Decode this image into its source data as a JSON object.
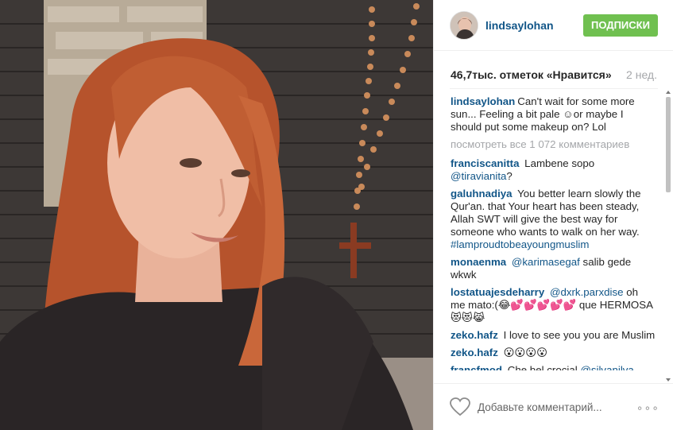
{
  "post": {
    "username": "lindsaylohan",
    "follow_label": "ПОДПИСКИ",
    "likes_text": "46,7тыс. отметок «Нравится»",
    "time_ago": "2 нед."
  },
  "caption": {
    "user": "lindsaylohan",
    "text": "Can't wait for some more sun... Feeling a bit pale ☺or maybe I should put some makeup on? Lol"
  },
  "view_all_text": "посмотреть все 1 072 комментариев",
  "comments": [
    {
      "user": "franciscanitta",
      "text_before": "Lambene sopo",
      "mention": "@tiravianita",
      "text_after": "?"
    },
    {
      "user": "galuhnadiya",
      "text_before": "You better learn slowly the Qur'an. that Your heart has been steady, Allah SWT will give the best way for someone who wants to walk on her way.",
      "mention": "#lamproudtobeayoungmuslim",
      "text_after": ""
    },
    {
      "user": "monaenma",
      "text_before": "",
      "mention": "@karimasegaf",
      "text_after": "salib gede wkwk"
    },
    {
      "user": "lostatuajesdeharry",
      "text_before": "",
      "mention": "@dxrk.parxdise",
      "text_after": "oh me mato:(😂💕💕💕💕💕 que HERMOSA😻😻😹"
    },
    {
      "user": "zeko.hafz",
      "text_before": "I love to see you you are Muslim",
      "mention": "",
      "text_after": ""
    },
    {
      "user": "zeko.hafz",
      "text_before": "😮😮😮😮",
      "mention": "",
      "text_after": ""
    },
    {
      "user": "francfmod",
      "text_before": "Che bel crocial",
      "mention": "@silvanilva",
      "text_after": ""
    }
  ],
  "add_comment_placeholder": "Добавьте комментарий...",
  "more_label": "∘∘∘",
  "colors": {
    "follow_button": "#70c050",
    "username": "#125688",
    "muted": "#a5a7aa"
  }
}
